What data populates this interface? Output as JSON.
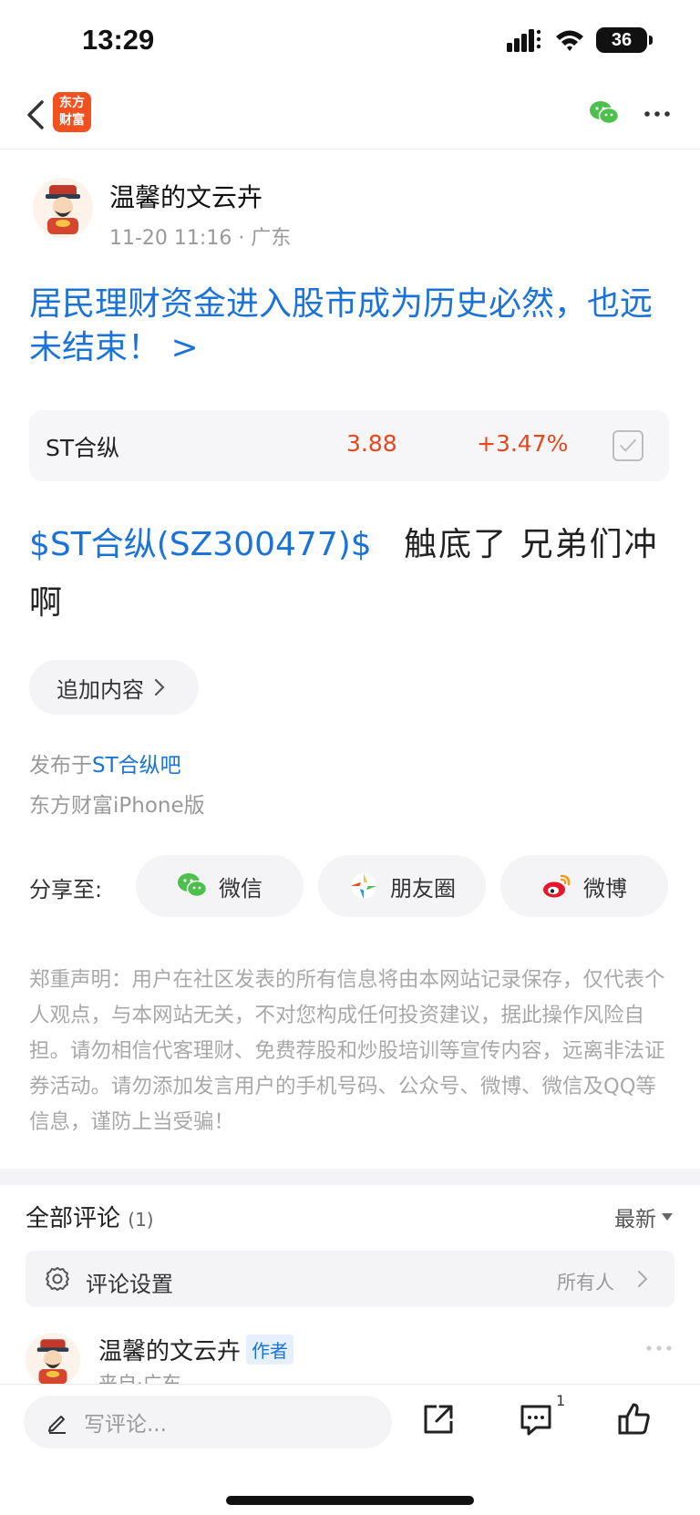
{
  "status_bar": {
    "time": "13:29",
    "battery": "36"
  },
  "nav": {
    "logo_line1": "东方",
    "logo_line2": "财富"
  },
  "author": {
    "name": "温馨的文云卉",
    "meta": "11-20 11:16 · 广东"
  },
  "post": {
    "title": "居民理财资金进入股市成为历史必然，也远未结束！ >",
    "stock_card": {
      "name": "ST合纵",
      "price": "3.88",
      "change": "+3.47%"
    },
    "body_stock_link": "$ST合纵(SZ300477)$",
    "body_text": "触底了 兄弟们冲啊",
    "append_label": "追加内容",
    "published_prefix": "发布于",
    "forum": "ST合纵吧",
    "client": "东方财富iPhone版"
  },
  "share": {
    "label": "分享至:",
    "wechat": "微信",
    "moments": "朋友圈",
    "weibo": "微博"
  },
  "disclaimer": "郑重声明：用户在社区发表的所有信息将由本网站记录保存，仅代表个人观点，与本网站无关，不对您构成任何投资建议，据此操作风险自担。请勿相信代客理财、免费荐股和炒股培训等宣传内容，远离非法证券活动。请勿添加发言用户的手机号码、公众号、微博、微信及QQ等信息，谨防上当受骗！",
  "comments": {
    "title": "全部评论",
    "count": "(1)",
    "sort": "最新",
    "settings_label": "评论设置",
    "settings_value": "所有人",
    "items": [
      {
        "author": "温馨的文云卉",
        "badge": "作者",
        "meta": "来自·广东"
      }
    ]
  },
  "toolbar": {
    "placeholder": "写评论...",
    "comment_count": "1"
  },
  "colors": {
    "link": "#1b73d9",
    "up": "#e8471d",
    "brand": "#f2501f"
  }
}
